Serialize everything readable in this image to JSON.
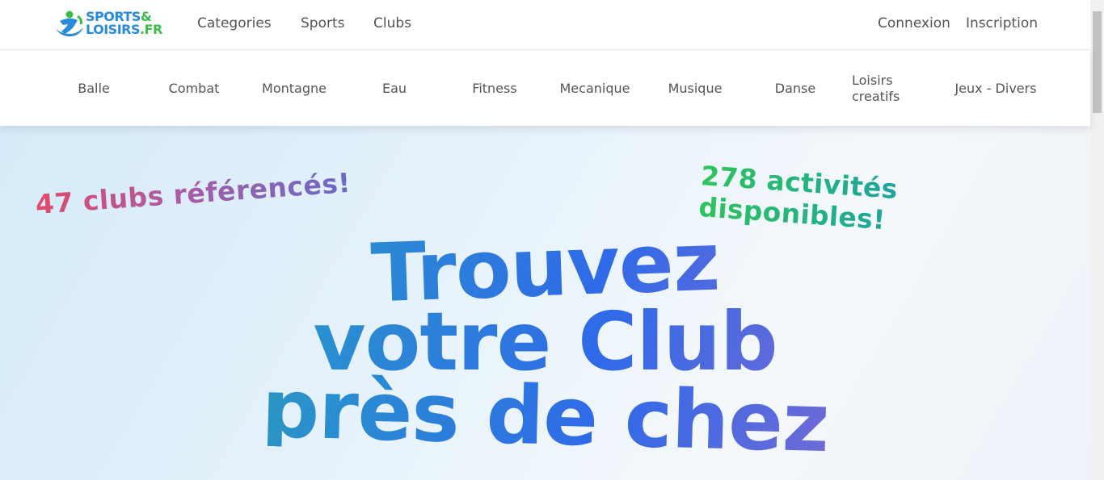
{
  "header": {
    "logo": {
      "line1": "SPORTS",
      "amp": "&",
      "line2": "LOISIRS",
      "tld": ".FR"
    },
    "nav": [
      "Categories",
      "Sports",
      "Clubs"
    ],
    "auth": {
      "login": "Connexion",
      "signup": "Inscription"
    }
  },
  "categories": [
    "Balle",
    "Combat",
    "Montagne",
    "Eau",
    "Fitness",
    "Mecanique",
    "Musique",
    "Danse",
    "Loisirs creatifs",
    "Jeux - Divers"
  ],
  "hero": {
    "clubs_count": "47 clubs référencés!",
    "activities_count": "278 activités disponibles!",
    "headline": [
      "Trouvez",
      "votre Club",
      "près de chez"
    ]
  },
  "colors": {
    "brand_blue": "#2a8bd8",
    "brand_green": "#3cbf4a",
    "hero_bg": "#d6ebf9"
  },
  "icons": {
    "logo": "runner-logo-icon"
  }
}
